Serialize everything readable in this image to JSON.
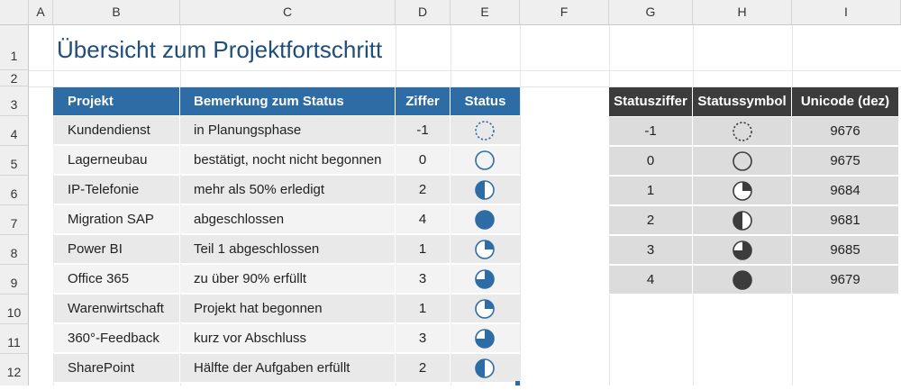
{
  "column_headers": [
    "A",
    "B",
    "C",
    "D",
    "E",
    "F",
    "G",
    "H",
    "I"
  ],
  "row_headers": [
    "1",
    "2",
    "3",
    "4",
    "5",
    "6",
    "7",
    "8",
    "9",
    "10",
    "11",
    "12"
  ],
  "title": "Übersicht zum Projektfortschritt",
  "colors": {
    "project_header": "#2e6ca6",
    "project_symbol": "#2e6ca6",
    "legend_header": "#3c3c3c",
    "legend_symbol": "#3c3c3c"
  },
  "project_table": {
    "headers": [
      "Projekt",
      "Bemerkung zum Status",
      "Ziffer",
      "Status"
    ],
    "rows": [
      {
        "projekt": "Kundendienst",
        "bemerkung": "in Planungsphase",
        "ziffer": "-1",
        "status": "dotted-circle-icon",
        "level": -1
      },
      {
        "projekt": "Lagerneubau",
        "bemerkung": "bestätigt, nocht nicht begonnen",
        "ziffer": "0",
        "status": "empty-circle-icon",
        "level": 0
      },
      {
        "projekt": "IP-Telefonie",
        "bemerkung": "mehr als 50% erledigt",
        "ziffer": "2",
        "status": "half-circle-icon",
        "level": 2
      },
      {
        "projekt": "Migration SAP",
        "bemerkung": "abgeschlossen",
        "ziffer": "4",
        "status": "full-circle-icon",
        "level": 4
      },
      {
        "projekt": "Power BI",
        "bemerkung": "Teil 1 abgeschlossen",
        "ziffer": "1",
        "status": "quarter-circle-icon",
        "level": 1
      },
      {
        "projekt": "Office 365",
        "bemerkung": "zu über 90% erfüllt",
        "ziffer": "3",
        "status": "three-quarter-circle-icon",
        "level": 3
      },
      {
        "projekt": "Warenwirtschaft",
        "bemerkung": "Projekt hat begonnen",
        "ziffer": "1",
        "status": "quarter-circle-icon",
        "level": 1
      },
      {
        "projekt": "360°-Feedback",
        "bemerkung": "kurz vor Abschluss",
        "ziffer": "3",
        "status": "three-quarter-circle-icon",
        "level": 3
      },
      {
        "projekt": "SharePoint",
        "bemerkung": "Hälfte der Aufgaben erfüllt",
        "ziffer": "2",
        "status": "half-circle-icon",
        "level": 2
      }
    ]
  },
  "legend_table": {
    "headers": [
      "Statusziffer",
      "Statussymbol",
      "Unicode (dez)"
    ],
    "rows": [
      {
        "ziffer": "-1",
        "symbol": "dotted-circle-icon",
        "unicode": "9676",
        "level": -1
      },
      {
        "ziffer": "0",
        "symbol": "empty-circle-icon",
        "unicode": "9675",
        "level": 0
      },
      {
        "ziffer": "1",
        "symbol": "quarter-circle-icon",
        "unicode": "9684",
        "level": 1
      },
      {
        "ziffer": "2",
        "symbol": "half-circle-icon",
        "unicode": "9681",
        "level": 2
      },
      {
        "ziffer": "3",
        "symbol": "three-quarter-circle-icon",
        "unicode": "9685",
        "level": 3
      },
      {
        "ziffer": "4",
        "symbol": "full-circle-icon",
        "unicode": "9679",
        "level": 4
      }
    ]
  }
}
